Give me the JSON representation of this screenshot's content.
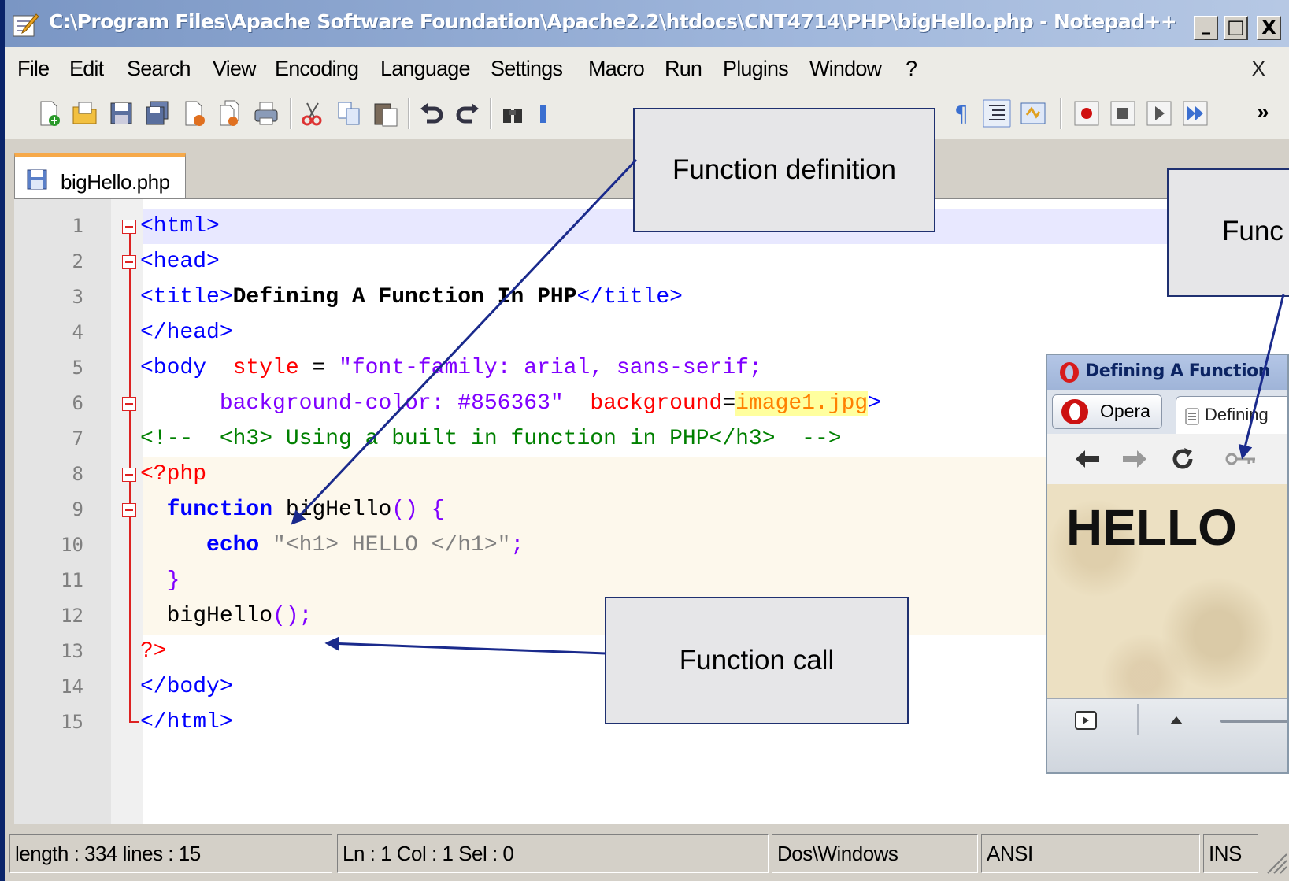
{
  "window": {
    "title": "C:\\Program Files\\Apache Software Foundation\\Apache2.2\\htdocs\\CNT4714\\PHP\\bigHello.php - Notepad++",
    "controls": {
      "minimize": "_",
      "maximize": "□",
      "close": "X"
    }
  },
  "menu": {
    "items": [
      "File",
      "Edit",
      "Search",
      "View",
      "Encoding",
      "Language",
      "Settings",
      "Macro",
      "Run",
      "Plugins",
      "Window",
      "?"
    ],
    "close_doc": "X"
  },
  "toolbar": {
    "icons": [
      "new-file-icon",
      "open-file-icon",
      "save-icon",
      "save-all-icon",
      "close-icon",
      "close-all-icon",
      "print-icon",
      "cut-icon",
      "copy-icon",
      "paste-icon",
      "undo-icon",
      "redo-icon",
      "find-icon",
      "find-replace-icon",
      "zoom-in-icon",
      "zoom-out-icon",
      "sync-vertical-icon",
      "sync-horizontal-icon",
      "word-wrap-icon",
      "show-all-chars-icon",
      "indent-guide-icon",
      "user-lang-icon",
      "record-macro-icon",
      "stop-record-icon",
      "play-macro-icon",
      "run-macro-multiple-icon"
    ],
    "overflow": "»"
  },
  "tab": {
    "label": "bigHello.php"
  },
  "editor": {
    "lines": [
      {
        "n": "1"
      },
      {
        "n": "2"
      },
      {
        "n": "3"
      },
      {
        "n": "4"
      },
      {
        "n": "5"
      },
      {
        "n": "6"
      },
      {
        "n": "7"
      },
      {
        "n": "8"
      },
      {
        "n": "9"
      },
      {
        "n": "10"
      },
      {
        "n": "11"
      },
      {
        "n": "12"
      },
      {
        "n": "13"
      },
      {
        "n": "14"
      },
      {
        "n": "15"
      }
    ],
    "code": {
      "l1_tag": "<html>",
      "l2_tag": "<head>",
      "l3_open": "<title>",
      "l3_text": "Defining A Function In PHP",
      "l3_close": "</title>",
      "l4_tag": "</head>",
      "l5_tag": "<body",
      "l5_attr": "style",
      "l5_eq": " = ",
      "l5_str": "\"font-family: arial, sans-serif;",
      "l6_str": "background-color: #856363\"",
      "l6_attr": "background",
      "l6_eq": "=",
      "l6_val": "image1.jpg",
      "l6_gt": ">",
      "l7_comment": "<!--  <h3> Using a built in function in PHP</h3>  -->",
      "l8_php": "<?php",
      "l9_kw": "function",
      "l9_name": " bigHello",
      "l9_rest": "() {",
      "l10_kw": "echo",
      "l10_str": " \"<h1> HELLO </h1>\"",
      "l10_semi": ";",
      "l11_brace": "}",
      "l12_call": "bigHello",
      "l12_rest": "();",
      "l13_php": "?>",
      "l14_tag": "</body>",
      "l15_tag": "</html>"
    }
  },
  "statusbar": {
    "length": "length : 334   lines : 15",
    "position": "Ln : 1   Col : 1   Sel : 0",
    "eol": "Dos\\Windows",
    "encoding": "ANSI",
    "mode": "INS"
  },
  "browser": {
    "title": "Defining A Function",
    "opera_button": "Opera",
    "tab_label": "Defining",
    "content_heading": "HELLO"
  },
  "callouts": {
    "definition": "Function definition",
    "call": "Function call",
    "output": "Func"
  },
  "colors": {
    "callout_border": "#1f3070",
    "arrow": "#1a2a8c",
    "fold_marker": "#dd2222",
    "title_gradient": "#7a96c4"
  }
}
